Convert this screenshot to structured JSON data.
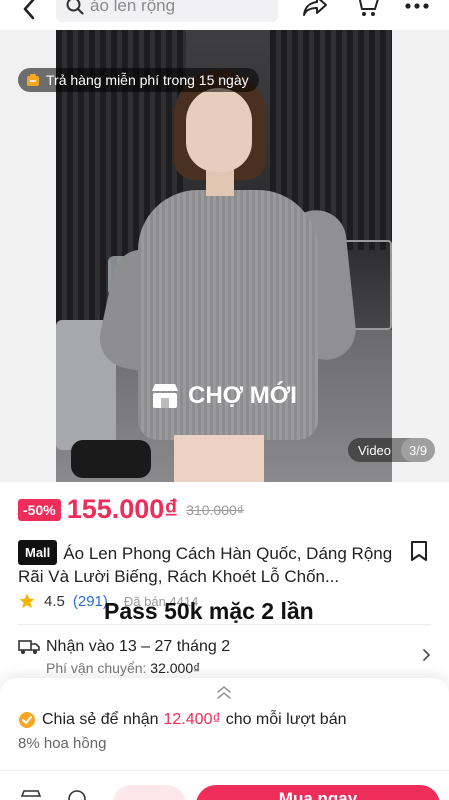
{
  "search": {
    "query": "áo len rộng"
  },
  "hero": {
    "return_badge": "Trả hàng miễn phí trong 15 ngày",
    "watermark": "CHỢ MỚI",
    "video_label": "Video",
    "image_counter": "3/9"
  },
  "price": {
    "discount": "-50%",
    "current": "155.000₫",
    "original": "310.000₫"
  },
  "product": {
    "mall_badge": "Mall",
    "title": "Áo Len Phong Cách Hàn Quốc, Dáng Rộng Rãi Và Lười Biếng, Rách Khoét Lỗ Chốn...",
    "rating": "4.5",
    "reviews": "(291)",
    "sold": "Đã bán 4414",
    "overlay_note": "Pass 50k mặc 2 lần"
  },
  "shipping": {
    "delivery": "Nhận vào 13 – 27 tháng 2",
    "fee_label": "Phí vận chuyển:",
    "fee_value": "32.000₫"
  },
  "share_sheet": {
    "prefix": "Chia sẻ để nhận",
    "amount": "12.400₫",
    "suffix": "cho mỗi lượt bán",
    "commission": "8% hoa hồng"
  },
  "bottom": {
    "buy_label": "Mua ngay"
  },
  "colors": {
    "accent": "#ee2d5a",
    "link": "#2a6bd8",
    "star": "#f5b400"
  }
}
